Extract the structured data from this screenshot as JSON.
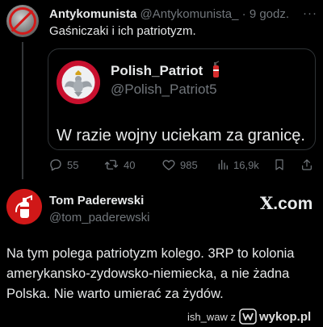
{
  "tweet": {
    "author_name": "Antykomunista",
    "author_handle": "@Antykomunista_",
    "separator": "·",
    "time": "9 godz.",
    "more": "···",
    "text": "Gaśniczaki i ich patriotyzm.",
    "quote": {
      "name": "Polish_Patriot",
      "emoji_icon": "fire-extinguisher-icon",
      "handle": "@Polish_Patriot5",
      "text": "W razie wojny uciekam za granicę."
    },
    "actions": {
      "replies": "55",
      "retweets": "40",
      "likes": "985",
      "views": "16,9k"
    }
  },
  "reply": {
    "author_name": "Tom Paderewski",
    "author_handle": "@tom_paderewski",
    "platform_logo": "X",
    "platform_logo_suffix": ".com",
    "text": "Na tym polega patriotyzm kolego. 3RP to kolonia amerykansko-zydowsko-niemiecka, a nie żadna Polska. Nie warto umierać za żydów."
  },
  "watermark": {
    "user": "ish_waw z",
    "site": "wykop.pl"
  },
  "colors": {
    "background": "#000000",
    "text_primary": "#e7e9ea",
    "text_secondary": "#71767b",
    "border": "#2f3336",
    "avatar_red": "#d01818"
  }
}
